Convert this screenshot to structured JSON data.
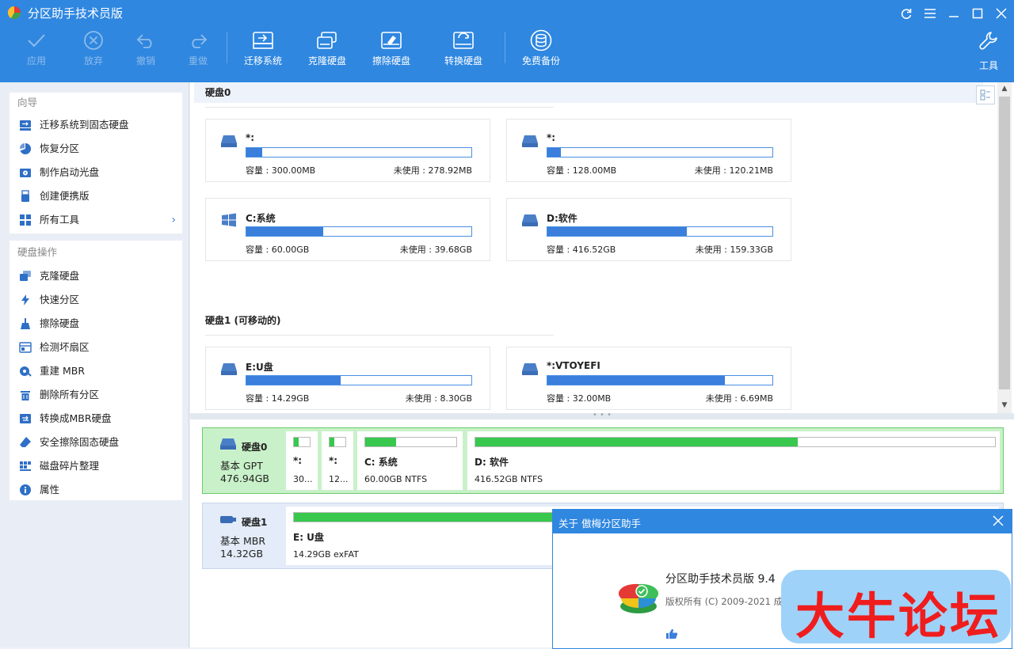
{
  "window": {
    "title": "分区助手技术员版",
    "controls": [
      "refresh-icon",
      "menu-icon",
      "minimize-icon",
      "maximize-icon",
      "close-icon"
    ]
  },
  "toolbar": {
    "apply": "应用",
    "discard": "放弃",
    "undo": "撤销",
    "redo": "重做",
    "migrate": "迁移系统",
    "clone": "克隆硬盘",
    "wipe": "擦除硬盘",
    "convert": "转换硬盘",
    "backup": "免费备份",
    "tools": "工具"
  },
  "sidebar": {
    "wizard_title": "向导",
    "wizard_items": [
      {
        "label": "迁移系统到固态硬盘",
        "icon": "migrate-icon"
      },
      {
        "label": "恢复分区",
        "icon": "pie-icon"
      },
      {
        "label": "制作启动光盘",
        "icon": "boot-disc-icon"
      },
      {
        "label": "创建便携版",
        "icon": "usb-icon"
      },
      {
        "label": "所有工具",
        "icon": "grid-icon"
      }
    ],
    "disk_ops_title": "硬盘操作",
    "disk_ops_items": [
      {
        "label": "克隆硬盘",
        "icon": "clone-icon"
      },
      {
        "label": "快速分区",
        "icon": "lightning-icon"
      },
      {
        "label": "擦除硬盘",
        "icon": "broom-icon"
      },
      {
        "label": "检测坏扇区",
        "icon": "scan-icon"
      },
      {
        "label": "重建 MBR",
        "icon": "rebuild-icon"
      },
      {
        "label": "删除所有分区",
        "icon": "trash-icon"
      },
      {
        "label": "转换成MBR硬盘",
        "icon": "convert-icon"
      },
      {
        "label": "安全擦除固态硬盘",
        "icon": "eraser-icon"
      },
      {
        "label": "磁盘碎片整理",
        "icon": "defrag-icon"
      },
      {
        "label": "属性",
        "icon": "info-icon"
      }
    ]
  },
  "disk_cards": {
    "disk0_title": "硬盘0",
    "disk1_title": "硬盘1 (可移动的)",
    "cap_prefix": "容量 : ",
    "free_prefix": "未使用 : ",
    "disk0": [
      {
        "name": "*:",
        "capacity": "300.00MB",
        "free": "278.92MB",
        "used": 0.07,
        "icon": "drive-icon"
      },
      {
        "name": "*:",
        "capacity": "128.00MB",
        "free": "120.21MB",
        "used": 0.06,
        "icon": "drive-icon"
      },
      {
        "name": "C:系统",
        "capacity": "60.00GB",
        "free": "39.68GB",
        "used": 0.34,
        "icon": "windows-icon"
      },
      {
        "name": "D:软件",
        "capacity": "416.52GB",
        "free": "159.33GB",
        "used": 0.62,
        "icon": "drive-icon"
      }
    ],
    "disk1": [
      {
        "name": "E:U盘",
        "capacity": "14.29GB",
        "free": "8.30GB",
        "used": 0.42,
        "icon": "drive-icon"
      },
      {
        "name": "*:VTOYEFI",
        "capacity": "32.00MB",
        "free": "6.69MB",
        "used": 0.79,
        "icon": "drive-icon"
      }
    ]
  },
  "disk_map": {
    "disk0": {
      "name": "硬盘0",
      "type": "基本 GPT",
      "size": "476.94GB",
      "partitions": [
        {
          "name": "*:",
          "info": "30...",
          "used": 0.3
        },
        {
          "name": "*:",
          "info": "12...",
          "used": 0.3
        },
        {
          "name": "C: 系统",
          "info": "60.00GB NTFS",
          "used": 0.34
        },
        {
          "name": "D: 软件",
          "info": "416.52GB NTFS",
          "used": 0.62
        }
      ]
    },
    "disk1": {
      "name": "硬盘1",
      "type": "基本 MBR",
      "size": "14.32GB",
      "partitions": [
        {
          "name": "E: U盘",
          "info": "14.29GB exFAT",
          "used": 0.42
        }
      ]
    }
  },
  "about": {
    "title": "关于 傲梅分区助手",
    "product": "分区助手技术员版 9.4",
    "copyright": "版权所有 (C) 2009-2021 成都"
  },
  "watermark": "大牛论坛",
  "colors": {
    "accent": "#2f87e0",
    "bar_blue": "#3a7fdc",
    "bar_green": "#37c84d",
    "selected_row": "#c9f1c9"
  }
}
